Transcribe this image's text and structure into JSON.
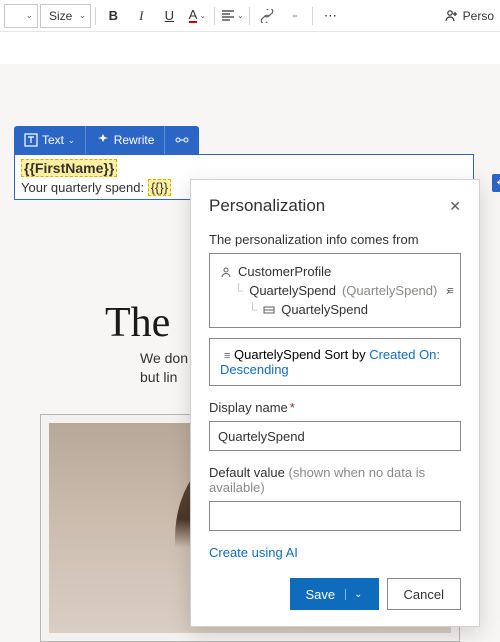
{
  "toolbar": {
    "size_label": "Size",
    "bold": "B",
    "italic": "I",
    "underline": "U",
    "font_color": "A",
    "more": "⋯",
    "perso_label": "Perso"
  },
  "float_toolbar": {
    "text": "Text",
    "rewrite": "Rewrite"
  },
  "selection": {
    "firstname_token": "{{FirstName}}",
    "spend_line_prefix": "Your quarterly spend: ",
    "spend_token": "{{}}"
  },
  "doc": {
    "headline": "The",
    "subcopy1": "We don",
    "subcopy2": "but lin"
  },
  "panel": {
    "title": "Personalization",
    "source_label": "The personalization info comes from",
    "tree": {
      "root": "CustomerProfile",
      "child1": "QuartelySpend",
      "child1_note": "(QuartelySpend)",
      "child2": "QuartelySpend"
    },
    "sort_field": "QuartelySpend",
    "sort_label": " Sort by ",
    "sort_value": "Created On: Descending",
    "display_name_label": "Display name",
    "display_name_value": "QuartelySpend",
    "default_label": "Default value",
    "default_hint": "(shown when no data is available)",
    "default_value": "",
    "ai_link": "Create using AI",
    "save": "Save",
    "cancel": "Cancel"
  }
}
